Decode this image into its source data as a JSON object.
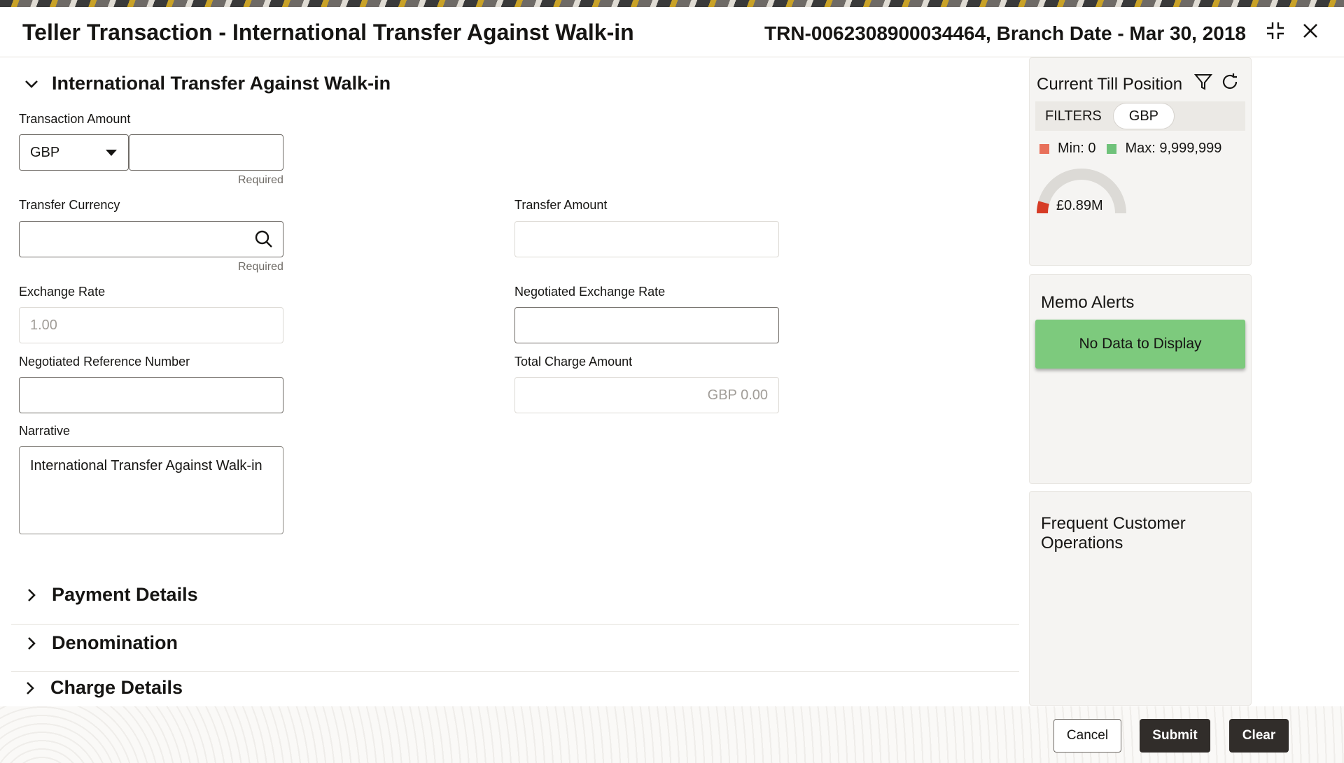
{
  "header": {
    "title": "Teller Transaction - International Transfer Against Walk-in",
    "transaction_info": "TRN-0062308900034464, Branch Date - Mar 30, 2018"
  },
  "main_section": {
    "title": "International Transfer Against Walk-in",
    "transaction_amount": {
      "label": "Transaction Amount",
      "currency": "GBP",
      "value": "",
      "hint": "Required"
    },
    "transfer_currency": {
      "label": "Transfer Currency",
      "value": "",
      "hint": "Required"
    },
    "transfer_amount": {
      "label": "Transfer Amount",
      "value": ""
    },
    "exchange_rate": {
      "label": "Exchange Rate",
      "value": "1.00"
    },
    "negotiated_exchange_rate": {
      "label": "Negotiated Exchange Rate",
      "value": ""
    },
    "negotiated_reference_number": {
      "label": "Negotiated Reference Number",
      "value": ""
    },
    "total_charge_amount": {
      "label": "Total Charge Amount",
      "value": "GBP 0.00"
    },
    "narrative": {
      "label": "Narrative",
      "value": "International Transfer Against Walk-in"
    }
  },
  "sections": {
    "payment_details": "Payment Details",
    "denomination": "Denomination",
    "charge_details": "Charge Details"
  },
  "till_position": {
    "title": "Current Till Position",
    "filters_label": "FILTERS",
    "filter_chip": "GBP",
    "min_label": "Min: 0",
    "max_label": "Max: 9,999,999",
    "gauge_value": "£0.89M",
    "gauge_fraction": 0.089,
    "colors": {
      "min": "#e8705a",
      "max": "#6fc27a",
      "gauge_fill": "#d63b25",
      "gauge_track": "#dcdad6"
    },
    "icons": [
      "filter-icon",
      "refresh-icon"
    ]
  },
  "memo_alerts": {
    "title": "Memo Alerts",
    "empty_text": "No Data to Display"
  },
  "frequent_ops": {
    "title_line1": "Frequent Customer",
    "title_line2": "Operations"
  },
  "footer": {
    "cancel": "Cancel",
    "submit": "Submit",
    "clear": "Clear"
  }
}
